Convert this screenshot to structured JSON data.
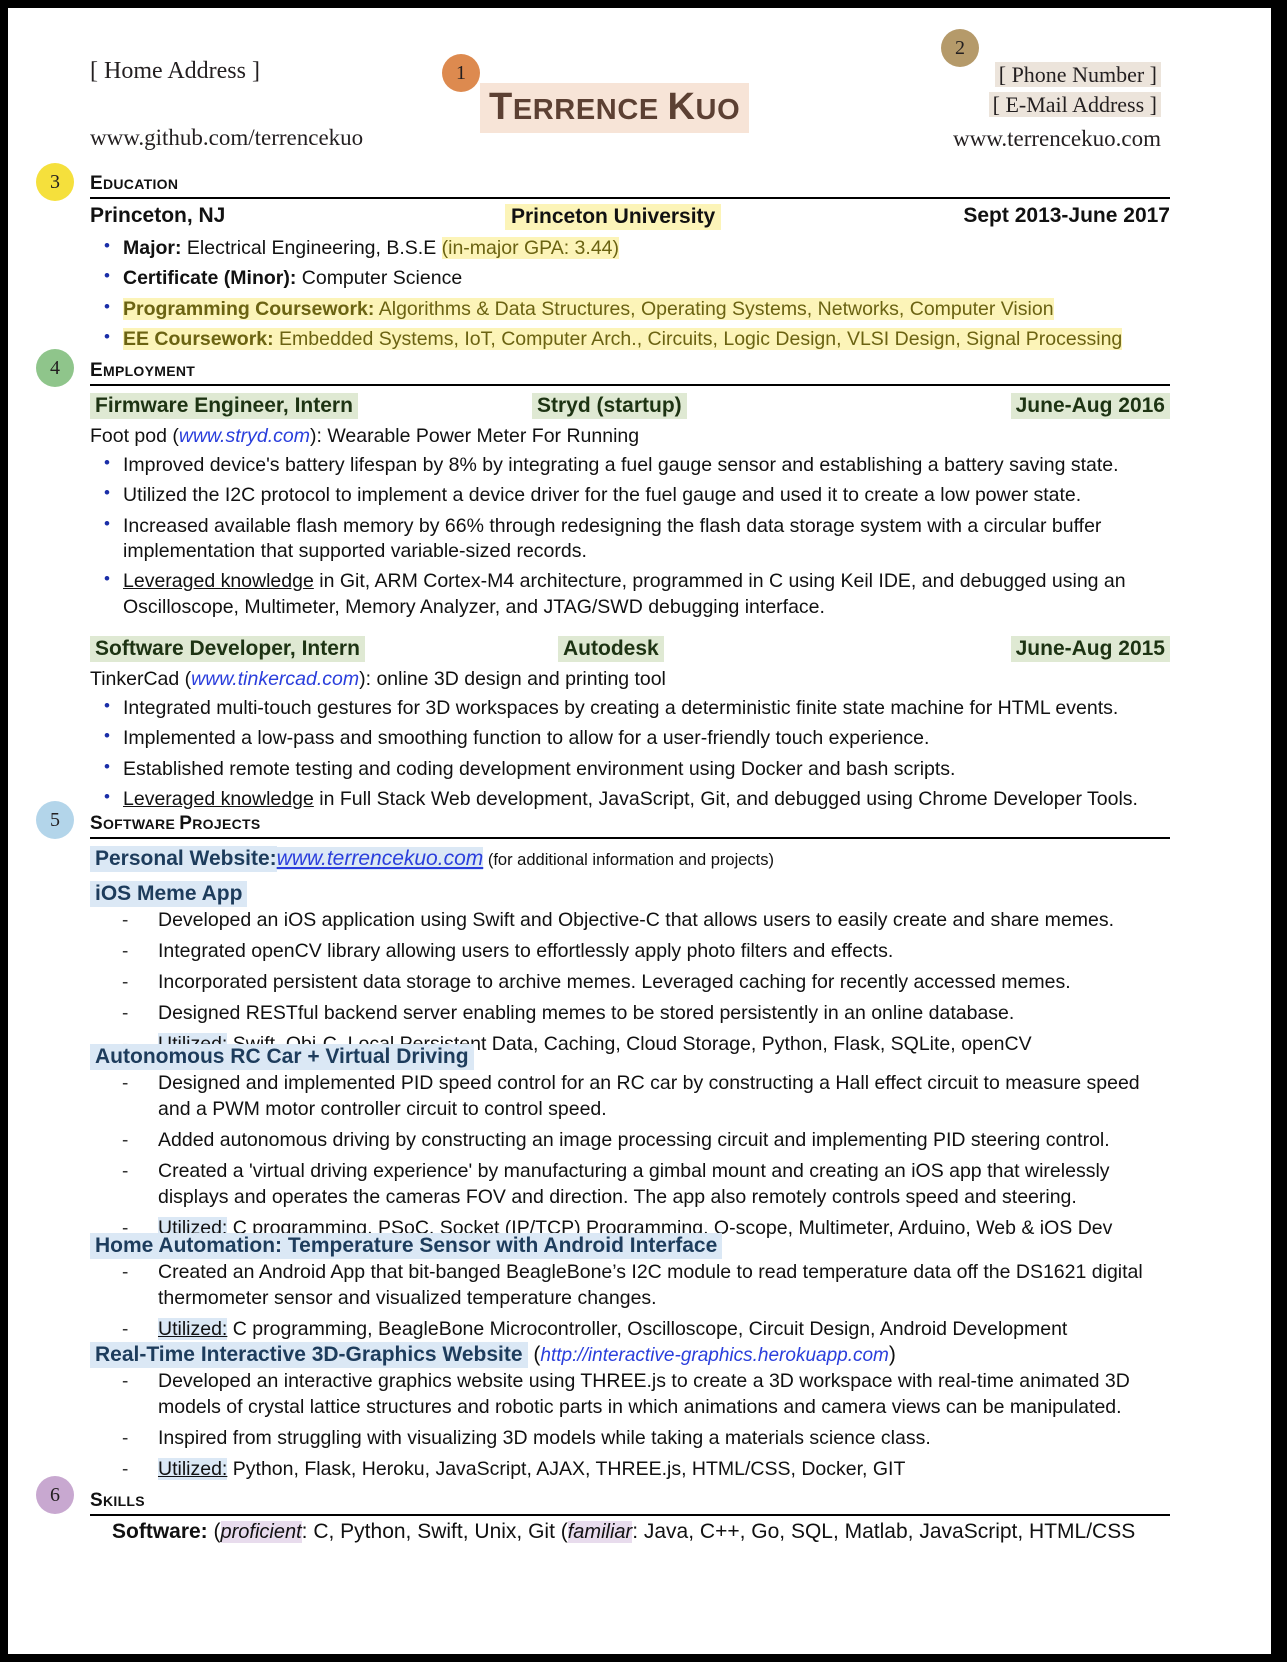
{
  "header": {
    "home_address": "[ Home Address ]",
    "github": "www.github.com/terrencekuo",
    "name_first_cap": "T",
    "name_first_rest": "ERRENCE",
    "name_last_cap": "K",
    "name_last_rest": "UO",
    "phone": "[ Phone Number ]",
    "email": "[ E-Mail Address ]",
    "website": "www.terrencekuo.com"
  },
  "callouts": [
    {
      "number": "1",
      "color": "#dd8a4f"
    },
    {
      "number": "2",
      "color": "#b59a6a"
    },
    {
      "number": "3",
      "color": "#f5e03c"
    },
    {
      "number": "4",
      "color": "#8fc58b"
    },
    {
      "number": "5",
      "color": "#b3d5ea"
    },
    {
      "number": "6",
      "color": "#c8a8d0"
    }
  ],
  "education": {
    "section_cap": "E",
    "section_rest": "DUCATION",
    "location": "Princeton, NJ",
    "school": "Princeton University",
    "dates": "Sept 2013-June 2017",
    "bullets": [
      {
        "label": "Major:",
        "text": " Electrical Engineering, B.S.E ",
        "extra": "(in-major GPA: 3.44)",
        "extra_style": "hl-y olive"
      },
      {
        "label": "Certificate (Minor):",
        "text": " Computer Science",
        "extra": "",
        "extra_style": ""
      },
      {
        "label": "Programming Coursework:",
        "text": " Algorithms & Data Structures, Operating Systems, Networks, Computer Vision",
        "extra": "",
        "extra_style": "",
        "row_style": "hl-y olive"
      },
      {
        "label": "EE Coursework:",
        "text": " Embedded Systems, IoT, Computer Arch., Circuits, Logic Design, VLSI Design, Signal Processing",
        "extra": "",
        "extra_style": "",
        "row_style": "hl-y olive"
      }
    ]
  },
  "employment": {
    "section_cap": "E",
    "section_rest": "MPLOYMENT",
    "jobs": [
      {
        "title": "Firmware Engineer, Intern",
        "company": "Stryd (startup)",
        "dates": "June-Aug 2016",
        "subtitle_pre": "Foot pod (",
        "subtitle_link": "www.stryd.com",
        "subtitle_post": "): Wearable Power Meter For Running",
        "bullets": [
          {
            "text": "Improved device's battery lifespan by 8% by integrating a fuel gauge sensor and establishing a battery saving state."
          },
          {
            "text": "Utilized the I2C protocol to implement a device driver for the fuel gauge and used it to create a low power state."
          },
          {
            "text": "Increased available flash memory by 66% through redesigning the flash data storage system with a circular buffer implementation that supported variable-sized records."
          },
          {
            "lead": "Leveraged knowledge",
            "text": " in Git, ARM Cortex-M4 architecture, programmed in C using Keil IDE, and debugged using an Oscilloscope, Multimeter, Memory Analyzer, and JTAG/SWD debugging interface."
          }
        ]
      },
      {
        "title": "Software Developer, Intern",
        "company": "Autodesk",
        "dates": "June-Aug 2015",
        "subtitle_pre": "TinkerCad (",
        "subtitle_link": "www.tinkercad.com",
        "subtitle_post": "): online 3D design and printing tool",
        "bullets": [
          {
            "text": "Integrated multi-touch gestures for 3D workspaces by creating a deterministic finite state machine for HTML events."
          },
          {
            "text": "Implemented a low-pass and smoothing function to allow for a user-friendly touch experience."
          },
          {
            "text": "Established remote testing and coding development environment using Docker and bash scripts."
          },
          {
            "lead": "Leveraged knowledge",
            "text": " in Full Stack Web development, JavaScript, Git, and debugged using Chrome Developer Tools."
          }
        ]
      }
    ]
  },
  "projects": {
    "section_cap_a": "S",
    "section_rest_a": "OFTWARE ",
    "section_cap_b": "P",
    "section_rest_b": "ROJECTS",
    "personal_label": "Personal Website:",
    "personal_link": "www.terrencekuo.com",
    "personal_note": "(for additional information and projects)",
    "items": [
      {
        "heading": "iOS Meme App",
        "bullets": [
          {
            "text": "Developed an iOS application using Swift and Objective-C that allows users to easily create and share memes."
          },
          {
            "text": "Integrated openCV library allowing users to effortlessly apply photo filters and effects."
          },
          {
            "text": "Incorporated persistent data storage to archive memes. Leveraged caching for recently accessed memes."
          },
          {
            "text": "Designed RESTful backend server enabling memes to be stored persistently in an online database."
          },
          {
            "lead": "Utilized:",
            "text": " Swift, Obj-C, Local Persistent Data, Caching, Cloud Storage, Python, Flask, SQLite, openCV"
          }
        ]
      },
      {
        "heading": "Autonomous RC Car + Virtual Driving",
        "bullets": [
          {
            "text": "Designed and implemented PID speed control for an RC car by constructing a Hall effect circuit to measure speed and a PWM motor controller circuit to control speed."
          },
          {
            "text": "Added autonomous driving by constructing an image processing circuit and implementing PID steering control."
          },
          {
            "text": "Created a 'virtual driving experience' by manufacturing a gimbal mount and creating an iOS app that wirelessly displays and operates the cameras FOV and direction. The app also remotely controls speed and steering."
          },
          {
            "lead": "Utilized:",
            "text": " C programming, PSoC, Socket (IP/TCP) Programming, O-scope, Multimeter, Arduino, Web & iOS Dev"
          }
        ]
      },
      {
        "heading": "Home Automation: Temperature Sensor with Android Interface",
        "bullets": [
          {
            "text": "Created an Android App that bit-banged BeagleBone’s I2C module to read temperature data off the DS1621 digital thermometer sensor and visualized temperature changes."
          },
          {
            "lead": "Utilized:",
            "text": " C programming, BeagleBone Microcontroller, Oscilloscope, Circuit Design, Android Development"
          }
        ]
      },
      {
        "heading": "Real-Time Interactive 3D-Graphics Website",
        "heading_link": "http://interactive-graphics.herokuapp.com",
        "bullets": [
          {
            "text": "Developed an interactive graphics website using THREE.js to create a 3D workspace with real-time animated 3D models of crystal lattice structures and robotic parts in which animations and camera views can be manipulated."
          },
          {
            "text": "Inspired from struggling with visualizing 3D models while taking a materials science class."
          },
          {
            "lead": "Utilized:",
            "text": " Python, Flask, Heroku, JavaScript, AJAX, THREE.js, HTML/CSS, Docker, GIT"
          }
        ]
      }
    ]
  },
  "skills": {
    "section_cap": "S",
    "section_rest": "KILLS",
    "software_label": "Software:",
    "proficient_label": "(proficient)",
    "proficient_list": ": C, Python, Swift, Unix, Git ",
    "familiar_label": "(familiar)",
    "familiar_list": ": Java, C++, Go, SQL, Matlab, JavaScript, HTML/CSS"
  }
}
